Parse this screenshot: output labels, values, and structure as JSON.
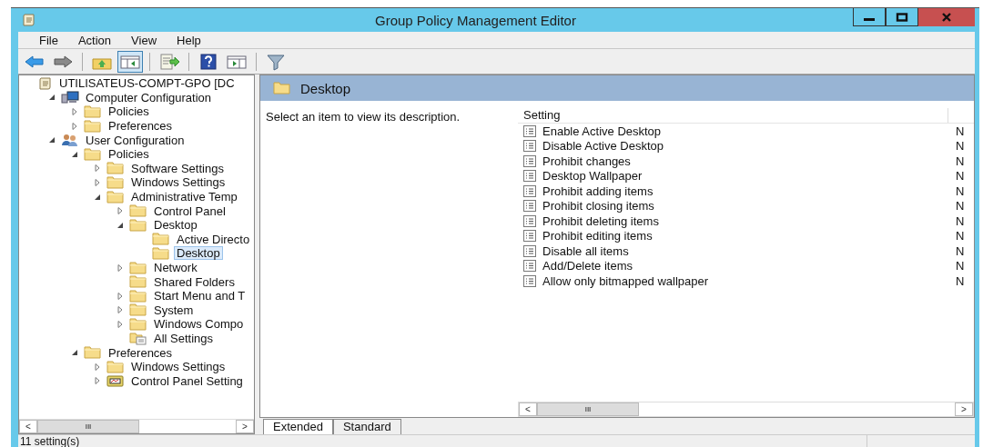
{
  "window": {
    "title": "Group Policy Management Editor"
  },
  "menu": [
    "File",
    "Action",
    "View",
    "Help"
  ],
  "toolbar": [
    {
      "kind": "back",
      "pressed": false
    },
    {
      "kind": "forward",
      "pressed": false
    },
    {
      "kind": "up",
      "pressed": false
    },
    {
      "kind": "tree",
      "pressed": true
    },
    {
      "kind": "export",
      "pressed": false
    },
    {
      "kind": "help",
      "pressed": false
    },
    {
      "kind": "console",
      "pressed": false
    },
    {
      "kind": "filter",
      "pressed": false
    }
  ],
  "tree": [
    {
      "label": "UTILISATEUS-COMPT-GPO [DC",
      "kind": "gpo",
      "selected": false,
      "children": [
        {
          "label": "Computer Configuration",
          "kind": "computer",
          "expanded": true,
          "selected": false,
          "children": [
            {
              "label": "Policies",
              "kind": "folder",
              "expanded": false,
              "selected": false
            },
            {
              "label": "Preferences",
              "kind": "folder",
              "expanded": false,
              "selected": false
            }
          ]
        },
        {
          "label": "User Configuration",
          "kind": "users",
          "expanded": true,
          "selected": false,
          "children": [
            {
              "label": "Policies",
              "kind": "folder",
              "expanded": true,
              "selected": false,
              "children": [
                {
                  "label": "Software Settings",
                  "kind": "folder",
                  "expanded": false,
                  "selected": false
                },
                {
                  "label": "Windows Settings",
                  "kind": "folder",
                  "expanded": false,
                  "selected": false
                },
                {
                  "label": "Administrative Temp",
                  "kind": "folder",
                  "expanded": true,
                  "selected": false,
                  "children": [
                    {
                      "label": "Control Panel",
                      "kind": "folder",
                      "expanded": false,
                      "selected": false
                    },
                    {
                      "label": "Desktop",
                      "kind": "folder",
                      "expanded": true,
                      "selected": false,
                      "children": [
                        {
                          "label": "Active Directo",
                          "kind": "folder",
                          "selected": false
                        },
                        {
                          "label": "Desktop",
                          "kind": "folder",
                          "selected": true
                        }
                      ]
                    },
                    {
                      "label": "Network",
                      "kind": "folder",
                      "expanded": false,
                      "selected": false
                    },
                    {
                      "label": "Shared Folders",
                      "kind": "folder",
                      "selected": false
                    },
                    {
                      "label": "Start Menu and T",
                      "kind": "folder",
                      "expanded": false,
                      "selected": false
                    },
                    {
                      "label": "System",
                      "kind": "folder",
                      "expanded": false,
                      "selected": false
                    },
                    {
                      "label": "Windows Compo",
                      "kind": "folder",
                      "expanded": false,
                      "selected": false
                    },
                    {
                      "label": "All Settings",
                      "kind": "settings",
                      "selected": false
                    }
                  ]
                }
              ]
            },
            {
              "label": "Preferences",
              "kind": "folder",
              "expanded": true,
              "selected": false,
              "children": [
                {
                  "label": "Windows Settings",
                  "kind": "folder",
                  "expanded": false,
                  "selected": false
                },
                {
                  "label": "Control Panel Setting",
                  "kind": "panel",
                  "expanded": false,
                  "selected": false
                }
              ]
            }
          ]
        }
      ]
    }
  ],
  "tree_scrollbar": {
    "left": "<",
    "grip": "III",
    "right": ">"
  },
  "panel": {
    "title": "Desktop",
    "description": "Select an item to view its description."
  },
  "table": {
    "columns": [
      "Setting"
    ],
    "rows": [
      {
        "setting": "Enable Active Desktop",
        "column_2": "N"
      },
      {
        "setting": "Disable Active Desktop",
        "column_2": "N"
      },
      {
        "setting": "Prohibit changes",
        "column_2": "N"
      },
      {
        "setting": "Desktop Wallpaper",
        "column_2": "N"
      },
      {
        "setting": "Prohibit adding items",
        "column_2": "N"
      },
      {
        "setting": "Prohibit closing items",
        "column_2": "N"
      },
      {
        "setting": "Prohibit deleting items",
        "column_2": "N"
      },
      {
        "setting": "Prohibit editing items",
        "column_2": "N"
      },
      {
        "setting": "Disable all items",
        "column_2": "N"
      },
      {
        "setting": "Add/Delete items",
        "column_2": "N"
      },
      {
        "setting": "Allow only bitmapped wallpaper",
        "column_2": "N"
      }
    ]
  },
  "table_scrollbar": {
    "left": "<",
    "grip": "III",
    "right": ">"
  },
  "tabs": [
    {
      "label": "Extended",
      "selected": true
    },
    {
      "label": "Standard",
      "selected": false
    }
  ],
  "status_bar": "11 setting(s)"
}
